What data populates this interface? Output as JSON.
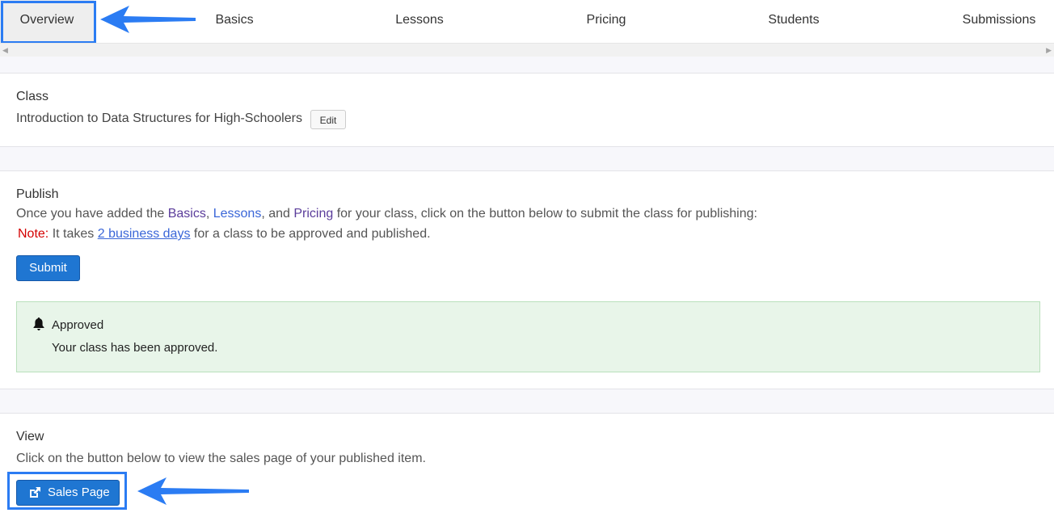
{
  "tabs": [
    {
      "label": "Overview",
      "active": true
    },
    {
      "label": "Basics"
    },
    {
      "label": "Lessons"
    },
    {
      "label": "Pricing"
    },
    {
      "label": "Students"
    },
    {
      "label": "Submissions"
    }
  ],
  "class_section": {
    "heading": "Class",
    "name": "Introduction to Data Structures for High-Schoolers",
    "edit_label": "Edit"
  },
  "publish_section": {
    "heading": "Publish",
    "line1_prefix": "Once you have added the ",
    "basics_link": "Basics",
    "comma1": ", ",
    "lessons_link": "Lessons",
    "and_text": ", and ",
    "pricing_link": "Pricing",
    "line1_suffix": " for your class, click on the button below to submit the class for publishing:",
    "note_label": "Note:",
    "note_prefix": " It takes ",
    "note_link": "2 business days",
    "note_suffix": " for a class to be approved and published.",
    "submit_label": "Submit",
    "alert": {
      "icon": "bell-icon",
      "title": "Approved",
      "message": "Your class has been approved."
    }
  },
  "view_section": {
    "heading": "View",
    "description": "Click on the button below to view the sales page of your published item.",
    "sales_page_label": "Sales Page"
  },
  "colors": {
    "primary_button": "#1f76d2",
    "highlight": "#2b7cf3",
    "alert_bg": "#e8f5e9",
    "note_red": "#d40000"
  }
}
